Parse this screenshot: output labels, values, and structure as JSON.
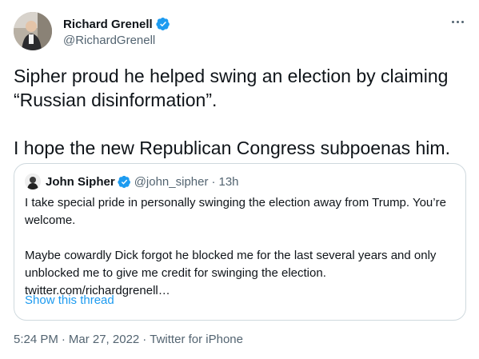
{
  "author": {
    "name": "Richard Grenell",
    "handle": "@RichardGrenell",
    "verified": true
  },
  "tweet": {
    "paragraphs": [
      "Sipher proud he helped swing an election by claiming “Russian disinformation”.",
      "I hope the new Republican Congress subpoenas him."
    ]
  },
  "quoted_tweet": {
    "name": "John Sipher",
    "handle": "@john_sipher",
    "separator": "·",
    "time": "13h",
    "paragraphs": [
      "I take special pride in personally swinging the election away from Trump. You’re welcome.",
      "Maybe cowardly Dick forgot he blocked me for the last several years and only unblocked me to give me credit for swinging the election."
    ],
    "link": "twitter.com/richardgrenell…",
    "show_thread": "Show this thread"
  },
  "meta": {
    "time": "5:24 PM",
    "separator": "·",
    "date": "Mar 27, 2022",
    "source": "Twitter for iPhone"
  },
  "icons": {
    "verified": "verified-badge-icon",
    "more": "more-dots-icon"
  },
  "colors": {
    "accent": "#1d9bf0",
    "secondary_text": "#536471",
    "border": "#cfd9de"
  }
}
